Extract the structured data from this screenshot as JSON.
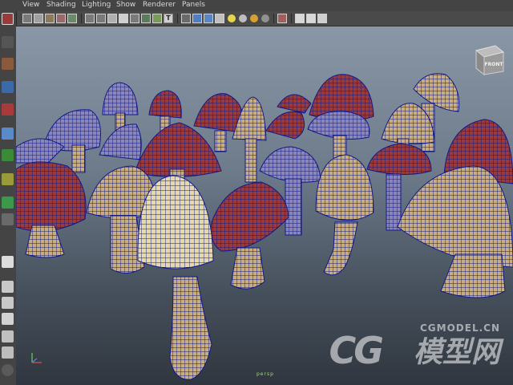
{
  "menu": [
    "View",
    "Shading",
    "Lighting",
    "Show",
    "Renderer",
    "Panels"
  ],
  "viewcube": {
    "face_label": "FRONT"
  },
  "camera_label": "persp",
  "watermark": {
    "logo": "CG",
    "brand": "模型网",
    "site": "CGMODEL.CN"
  },
  "toolbar_text": {
    "text_button": "T"
  },
  "colors": {
    "wire": "#111a8a",
    "cap_red": "#9a3a3a",
    "cap_tan": "#c8ad80",
    "highlight": "#e3d8b0",
    "persp_text": "#9fe06a"
  },
  "icons": {
    "tools": [
      "select-icon",
      "lasso-icon",
      "paint-icon",
      "move-icon",
      "rotate-icon",
      "scale-icon",
      "manipulator-icon",
      "soft-mod-icon",
      "show-manipulator-icon",
      "last-tool-icon",
      "layout-single-icon",
      "layout-four-icon",
      "layout-persp-icon",
      "layout-outliner-icon",
      "layout-graph-icon",
      "layout-hypershade-icon"
    ],
    "toolbar": [
      "camera-attributes-icon",
      "bookmark-icon",
      "image-plane-icon",
      "two-d-pan-icon",
      "grease-pencil-icon",
      "grid-icon",
      "film-gate-icon",
      "resolution-gate-icon",
      "gate-mask-icon",
      "field-chart-icon",
      "safe-action-icon",
      "text-overlay-icon",
      "wireframe-icon",
      "smooth-shade-icon",
      "wireframe-on-shaded-icon",
      "textured-icon",
      "use-default-light-icon",
      "all-lights-icon",
      "shadows-icon",
      "isolate-select-icon",
      "xray-icon",
      "xray-joints-icon",
      "xray-components-icon"
    ]
  }
}
